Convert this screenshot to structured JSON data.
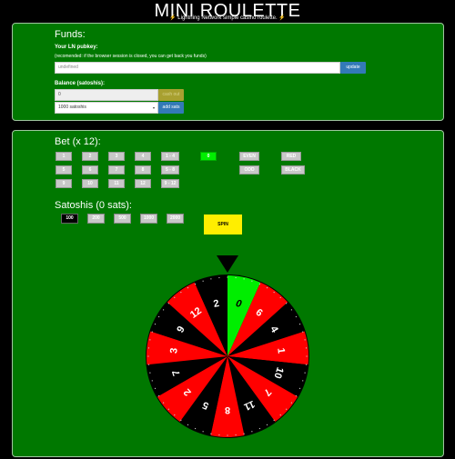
{
  "header": {
    "title": "MINI ROULETTE",
    "subtitle": "⚡ Lightning Network simple casino roulette. ⚡"
  },
  "funds": {
    "heading": "Funds:",
    "pubkey_label": "Your LN pubkey:",
    "pubkey_note": "(recomended: if the browser session is closed, you can get back you funds)",
    "pubkey_value": "undefined",
    "update_label": "update",
    "balance_label": "Balance (satoshis):",
    "balance_value": "0",
    "cashout_label": "cash out",
    "amount_selected": "1000 satoshis",
    "add_label": "add sats"
  },
  "bet": {
    "heading": "Bet (x 12):",
    "numbers": [
      "1",
      "2",
      "3",
      "4",
      "5",
      "6",
      "7",
      "8",
      "9",
      "10",
      "11",
      "12"
    ],
    "ranges": [
      "1 - 4",
      "5 - 8",
      "9 - 12"
    ],
    "zero": "0",
    "even": "EVEN",
    "odd": "ODD",
    "red": "RED",
    "black": "BLACK"
  },
  "sats": {
    "heading": "Satoshis (0 sats):",
    "amounts": [
      "100",
      "200",
      "500",
      "1000",
      "2000"
    ],
    "selected": "100",
    "spin_label": "SPIN"
  },
  "wheel": {
    "pockets": [
      "0",
      "6",
      "4",
      "1",
      "10",
      "7",
      "11",
      "8",
      "5",
      "2",
      "7",
      "3",
      "9",
      "12",
      "2"
    ],
    "pocket_colors": [
      "green",
      "red",
      "black",
      "red",
      "black",
      "red",
      "black",
      "red",
      "black",
      "red",
      "black",
      "red",
      "black",
      "red",
      "black"
    ],
    "colors": {
      "green": "#00ee00",
      "red": "#ff0000",
      "black": "#000000"
    }
  }
}
